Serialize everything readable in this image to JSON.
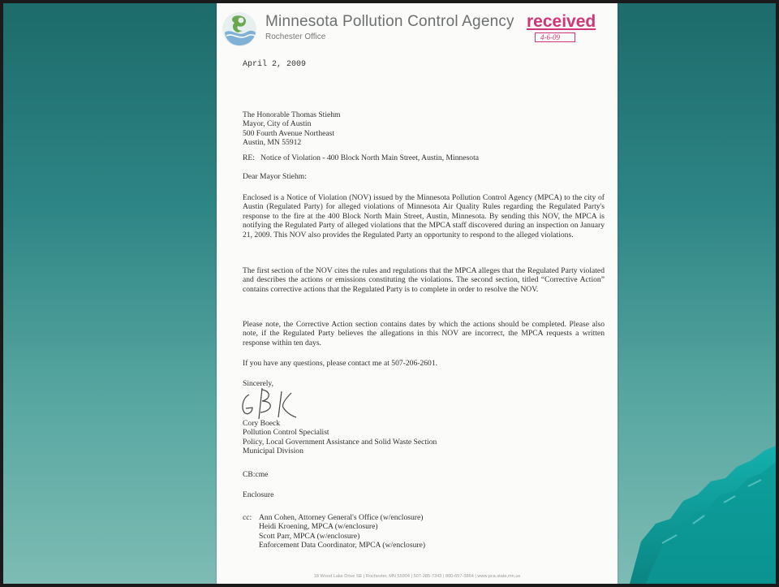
{
  "letterhead": {
    "agency": "Minnesota Pollution Control Agency",
    "office": "Rochester Office",
    "stamp_word": "received",
    "stamp_date": "4-6-09"
  },
  "date": "April 2, 2009",
  "address": [
    "The Honorable Thomas Stiehm",
    "Mayor, City of Austin",
    "500 Fourth Avenue Northeast",
    "Austin, MN  55912"
  ],
  "re_line": "RE:   Notice of Violation - 400 Block North Main Street, Austin, Minnesota",
  "salutation": "Dear Mayor Stiehm:",
  "paragraphs": [
    "Enclosed is a Notice of Violation (NOV) issued by the Minnesota Pollution Control Agency (MPCA) to the city of Austin (Regulated Party) for alleged violations of Minnesota Air Quality Rules regarding the Regulated Party's response to the fire at the 400 Block North Main Street, Austin, Minnesota. By sending this NOV, the MPCA is notifying the Regulated Party of alleged violations that the MPCA staff discovered during an inspection on January 21, 2009. This NOV also provides the Regulated Party an opportunity to respond to the alleged violations.",
    "The first section of the NOV cites the rules and regulations that the MPCA alleges that the Regulated Party violated and describes the actions or emissions constituting the violations. The second section, titled “Corrective Action” contains corrective actions that the Regulated Party is to complete in order to resolve the NOV.",
    "Please note, the Corrective Action section contains dates by which the actions should be completed. Please also note, if the Regulated Party believes the allegations in this NOV are incorrect, the MPCA requests a written response within ten days.",
    "If you have any questions, please contact me at 507-206-2601."
  ],
  "closing": "Sincerely,",
  "signer": [
    "Cory Boeck",
    "Pollution Control Specialist",
    "Policy, Local Government Assistance and Solid Waste Section",
    "Municipal Division"
  ],
  "initials": "CB:cme",
  "enclosure": "Enclosure",
  "cc_label": "cc:",
  "cc": [
    "Ann Cohen, Attorney General's Office (w/enclosure)",
    "Heidi Kroening, MPCA (w/enclosure)",
    "Scott Parr, MPCA (w/enclosure)",
    "Enforcement Data Coordinator, MPCA (w/enclosure)"
  ],
  "footer": "18 Wood Lake Drive SE  |  Rochester, MN 55904  |  507-285-7343  |  800-657-3864  |  www.pca.state.mn.us",
  "colors": {
    "background_top": "#1d6b6b",
    "background_bottom": "#7dbcb4",
    "stamp": "#d0357a",
    "mountain": "#0e9a98"
  }
}
